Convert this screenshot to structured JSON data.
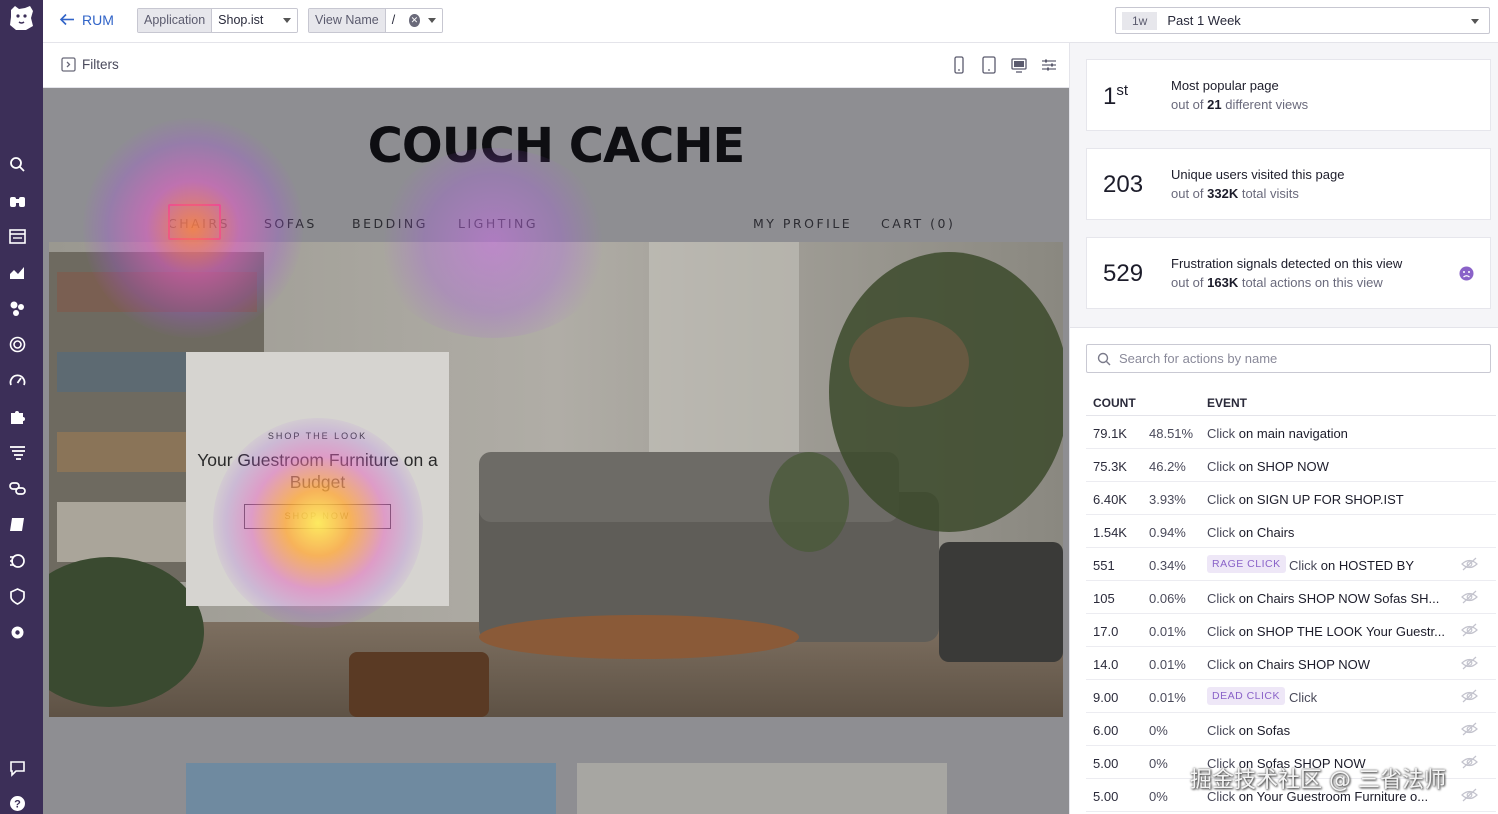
{
  "topbar": {
    "back_label": "RUM",
    "app_selector": {
      "label": "Application",
      "value": "Shop.ist"
    },
    "view_selector": {
      "label": "View Name",
      "value": "/"
    },
    "time": {
      "badge": "1w",
      "label": "Past 1 Week"
    }
  },
  "filters": {
    "label": "Filters"
  },
  "site": {
    "title": "COUCH CACHE",
    "nav": [
      "CHAIRS",
      "SOFAS",
      "BEDDING",
      "LIGHTING",
      "MY PROFILE",
      "CART (0)"
    ],
    "card": {
      "kicker": "SHOP THE LOOK",
      "headline": "Your Guestroom Furniture on a Budget",
      "button": "SHOP NOW"
    }
  },
  "stats": [
    {
      "number": "1",
      "suffix": "st",
      "line1": "Most popular page",
      "line2_pre": "out of ",
      "line2_bold": "21",
      "line2_post": " different views"
    },
    {
      "number": "203",
      "suffix": "",
      "line1": "Unique users visited this page",
      "line2_pre": "out of ",
      "line2_bold": "332K",
      "line2_post": " total visits"
    },
    {
      "number": "529",
      "suffix": "",
      "line1": "Frustration signals detected on this view",
      "line2_pre": "out of ",
      "line2_bold": "163K",
      "line2_post": " total actions on this view"
    }
  ],
  "search": {
    "placeholder": "Search for actions by name"
  },
  "table": {
    "headers": {
      "count": "COUNT",
      "event": "EVENT"
    },
    "rows": [
      {
        "count": "79.1K",
        "pct": "48.51%",
        "tag": "",
        "action": "Click",
        "target": "main navigation"
      },
      {
        "count": "75.3K",
        "pct": "46.2%",
        "tag": "",
        "action": "Click",
        "target": "SHOP NOW"
      },
      {
        "count": "6.40K",
        "pct": "3.93%",
        "tag": "",
        "action": "Click",
        "target": "SIGN UP FOR SHOP.IST"
      },
      {
        "count": "1.54K",
        "pct": "0.94%",
        "tag": "",
        "action": "Click",
        "target": "Chairs"
      },
      {
        "count": "551",
        "pct": "0.34%",
        "tag": "RAGE CLICK",
        "action": "Click",
        "target": "HOSTED BY"
      },
      {
        "count": "105",
        "pct": "0.06%",
        "tag": "",
        "action": "Click",
        "target": "Chairs SHOP NOW Sofas SH..."
      },
      {
        "count": "17.0",
        "pct": "0.01%",
        "tag": "",
        "action": "Click",
        "target": "SHOP THE LOOK Your Guestr..."
      },
      {
        "count": "14.0",
        "pct": "0.01%",
        "tag": "",
        "action": "Click",
        "target": "Chairs SHOP NOW"
      },
      {
        "count": "9.00",
        "pct": "0.01%",
        "tag": "DEAD CLICK",
        "action": "Click",
        "target": ""
      },
      {
        "count": "6.00",
        "pct": "0%",
        "tag": "",
        "action": "Click",
        "target": "Sofas"
      },
      {
        "count": "5.00",
        "pct": "0%",
        "tag": "",
        "action": "Click",
        "target": "Sofas SHOP NOW"
      },
      {
        "count": "5.00",
        "pct": "0%",
        "tag": "",
        "action": "Click",
        "target": "Your Guestroom Furniture o..."
      }
    ]
  },
  "watermark": "掘金技术社区 @ 三省法师",
  "colors": {
    "sidebar": "#3c2f58",
    "link": "#3164c8",
    "tag_bg": "#eee7f7",
    "tag_fg": "#8a62c8"
  }
}
